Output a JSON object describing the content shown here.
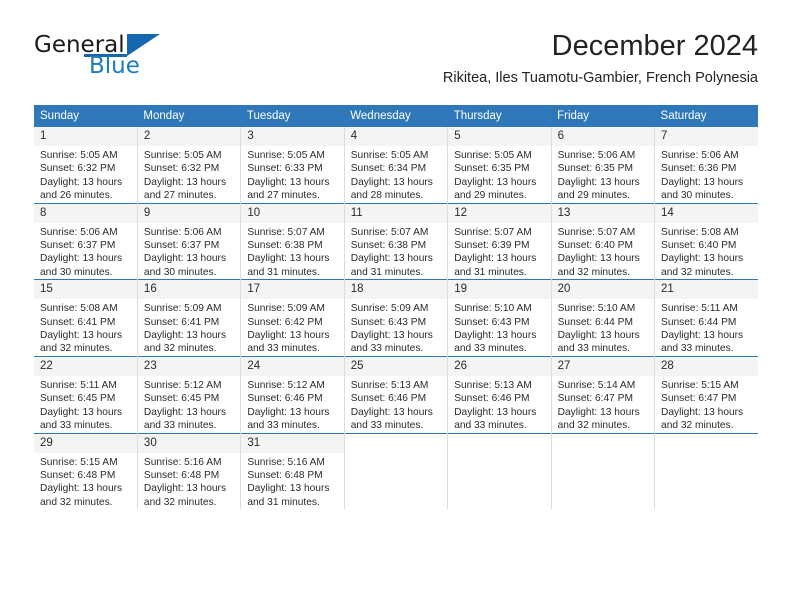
{
  "logo": {
    "word1": "General",
    "word2": "Blue",
    "accent_color": "#1567b0",
    "triangle_icon": "triangle-icon"
  },
  "header": {
    "title": "December 2024",
    "subtitle": "Rikitea, Iles Tuamotu-Gambier, French Polynesia"
  },
  "calendar": {
    "header_bg": "#2e77b8",
    "daynum_bg": "#f4f4f4",
    "weekdays": [
      "Sunday",
      "Monday",
      "Tuesday",
      "Wednesday",
      "Thursday",
      "Friday",
      "Saturday"
    ],
    "weeks": [
      [
        {
          "day": "1",
          "sunrise": "Sunrise: 5:05 AM",
          "sunset": "Sunset: 6:32 PM",
          "daylight1": "Daylight: 13 hours",
          "daylight2": "and 26 minutes."
        },
        {
          "day": "2",
          "sunrise": "Sunrise: 5:05 AM",
          "sunset": "Sunset: 6:32 PM",
          "daylight1": "Daylight: 13 hours",
          "daylight2": "and 27 minutes."
        },
        {
          "day": "3",
          "sunrise": "Sunrise: 5:05 AM",
          "sunset": "Sunset: 6:33 PM",
          "daylight1": "Daylight: 13 hours",
          "daylight2": "and 27 minutes."
        },
        {
          "day": "4",
          "sunrise": "Sunrise: 5:05 AM",
          "sunset": "Sunset: 6:34 PM",
          "daylight1": "Daylight: 13 hours",
          "daylight2": "and 28 minutes."
        },
        {
          "day": "5",
          "sunrise": "Sunrise: 5:05 AM",
          "sunset": "Sunset: 6:35 PM",
          "daylight1": "Daylight: 13 hours",
          "daylight2": "and 29 minutes."
        },
        {
          "day": "6",
          "sunrise": "Sunrise: 5:06 AM",
          "sunset": "Sunset: 6:35 PM",
          "daylight1": "Daylight: 13 hours",
          "daylight2": "and 29 minutes."
        },
        {
          "day": "7",
          "sunrise": "Sunrise: 5:06 AM",
          "sunset": "Sunset: 6:36 PM",
          "daylight1": "Daylight: 13 hours",
          "daylight2": "and 30 minutes."
        }
      ],
      [
        {
          "day": "8",
          "sunrise": "Sunrise: 5:06 AM",
          "sunset": "Sunset: 6:37 PM",
          "daylight1": "Daylight: 13 hours",
          "daylight2": "and 30 minutes."
        },
        {
          "day": "9",
          "sunrise": "Sunrise: 5:06 AM",
          "sunset": "Sunset: 6:37 PM",
          "daylight1": "Daylight: 13 hours",
          "daylight2": "and 30 minutes."
        },
        {
          "day": "10",
          "sunrise": "Sunrise: 5:07 AM",
          "sunset": "Sunset: 6:38 PM",
          "daylight1": "Daylight: 13 hours",
          "daylight2": "and 31 minutes."
        },
        {
          "day": "11",
          "sunrise": "Sunrise: 5:07 AM",
          "sunset": "Sunset: 6:38 PM",
          "daylight1": "Daylight: 13 hours",
          "daylight2": "and 31 minutes."
        },
        {
          "day": "12",
          "sunrise": "Sunrise: 5:07 AM",
          "sunset": "Sunset: 6:39 PM",
          "daylight1": "Daylight: 13 hours",
          "daylight2": "and 31 minutes."
        },
        {
          "day": "13",
          "sunrise": "Sunrise: 5:07 AM",
          "sunset": "Sunset: 6:40 PM",
          "daylight1": "Daylight: 13 hours",
          "daylight2": "and 32 minutes."
        },
        {
          "day": "14",
          "sunrise": "Sunrise: 5:08 AM",
          "sunset": "Sunset: 6:40 PM",
          "daylight1": "Daylight: 13 hours",
          "daylight2": "and 32 minutes."
        }
      ],
      [
        {
          "day": "15",
          "sunrise": "Sunrise: 5:08 AM",
          "sunset": "Sunset: 6:41 PM",
          "daylight1": "Daylight: 13 hours",
          "daylight2": "and 32 minutes."
        },
        {
          "day": "16",
          "sunrise": "Sunrise: 5:09 AM",
          "sunset": "Sunset: 6:41 PM",
          "daylight1": "Daylight: 13 hours",
          "daylight2": "and 32 minutes."
        },
        {
          "day": "17",
          "sunrise": "Sunrise: 5:09 AM",
          "sunset": "Sunset: 6:42 PM",
          "daylight1": "Daylight: 13 hours",
          "daylight2": "and 33 minutes."
        },
        {
          "day": "18",
          "sunrise": "Sunrise: 5:09 AM",
          "sunset": "Sunset: 6:43 PM",
          "daylight1": "Daylight: 13 hours",
          "daylight2": "and 33 minutes."
        },
        {
          "day": "19",
          "sunrise": "Sunrise: 5:10 AM",
          "sunset": "Sunset: 6:43 PM",
          "daylight1": "Daylight: 13 hours",
          "daylight2": "and 33 minutes."
        },
        {
          "day": "20",
          "sunrise": "Sunrise: 5:10 AM",
          "sunset": "Sunset: 6:44 PM",
          "daylight1": "Daylight: 13 hours",
          "daylight2": "and 33 minutes."
        },
        {
          "day": "21",
          "sunrise": "Sunrise: 5:11 AM",
          "sunset": "Sunset: 6:44 PM",
          "daylight1": "Daylight: 13 hours",
          "daylight2": "and 33 minutes."
        }
      ],
      [
        {
          "day": "22",
          "sunrise": "Sunrise: 5:11 AM",
          "sunset": "Sunset: 6:45 PM",
          "daylight1": "Daylight: 13 hours",
          "daylight2": "and 33 minutes."
        },
        {
          "day": "23",
          "sunrise": "Sunrise: 5:12 AM",
          "sunset": "Sunset: 6:45 PM",
          "daylight1": "Daylight: 13 hours",
          "daylight2": "and 33 minutes."
        },
        {
          "day": "24",
          "sunrise": "Sunrise: 5:12 AM",
          "sunset": "Sunset: 6:46 PM",
          "daylight1": "Daylight: 13 hours",
          "daylight2": "and 33 minutes."
        },
        {
          "day": "25",
          "sunrise": "Sunrise: 5:13 AM",
          "sunset": "Sunset: 6:46 PM",
          "daylight1": "Daylight: 13 hours",
          "daylight2": "and 33 minutes."
        },
        {
          "day": "26",
          "sunrise": "Sunrise: 5:13 AM",
          "sunset": "Sunset: 6:46 PM",
          "daylight1": "Daylight: 13 hours",
          "daylight2": "and 33 minutes."
        },
        {
          "day": "27",
          "sunrise": "Sunrise: 5:14 AM",
          "sunset": "Sunset: 6:47 PM",
          "daylight1": "Daylight: 13 hours",
          "daylight2": "and 32 minutes."
        },
        {
          "day": "28",
          "sunrise": "Sunrise: 5:15 AM",
          "sunset": "Sunset: 6:47 PM",
          "daylight1": "Daylight: 13 hours",
          "daylight2": "and 32 minutes."
        }
      ],
      [
        {
          "day": "29",
          "sunrise": "Sunrise: 5:15 AM",
          "sunset": "Sunset: 6:48 PM",
          "daylight1": "Daylight: 13 hours",
          "daylight2": "and 32 minutes."
        },
        {
          "day": "30",
          "sunrise": "Sunrise: 5:16 AM",
          "sunset": "Sunset: 6:48 PM",
          "daylight1": "Daylight: 13 hours",
          "daylight2": "and 32 minutes."
        },
        {
          "day": "31",
          "sunrise": "Sunrise: 5:16 AM",
          "sunset": "Sunset: 6:48 PM",
          "daylight1": "Daylight: 13 hours",
          "daylight2": "and 31 minutes."
        },
        {
          "day": "",
          "sunrise": "",
          "sunset": "",
          "daylight1": "",
          "daylight2": ""
        },
        {
          "day": "",
          "sunrise": "",
          "sunset": "",
          "daylight1": "",
          "daylight2": ""
        },
        {
          "day": "",
          "sunrise": "",
          "sunset": "",
          "daylight1": "",
          "daylight2": ""
        },
        {
          "day": "",
          "sunrise": "",
          "sunset": "",
          "daylight1": "",
          "daylight2": ""
        }
      ]
    ]
  }
}
